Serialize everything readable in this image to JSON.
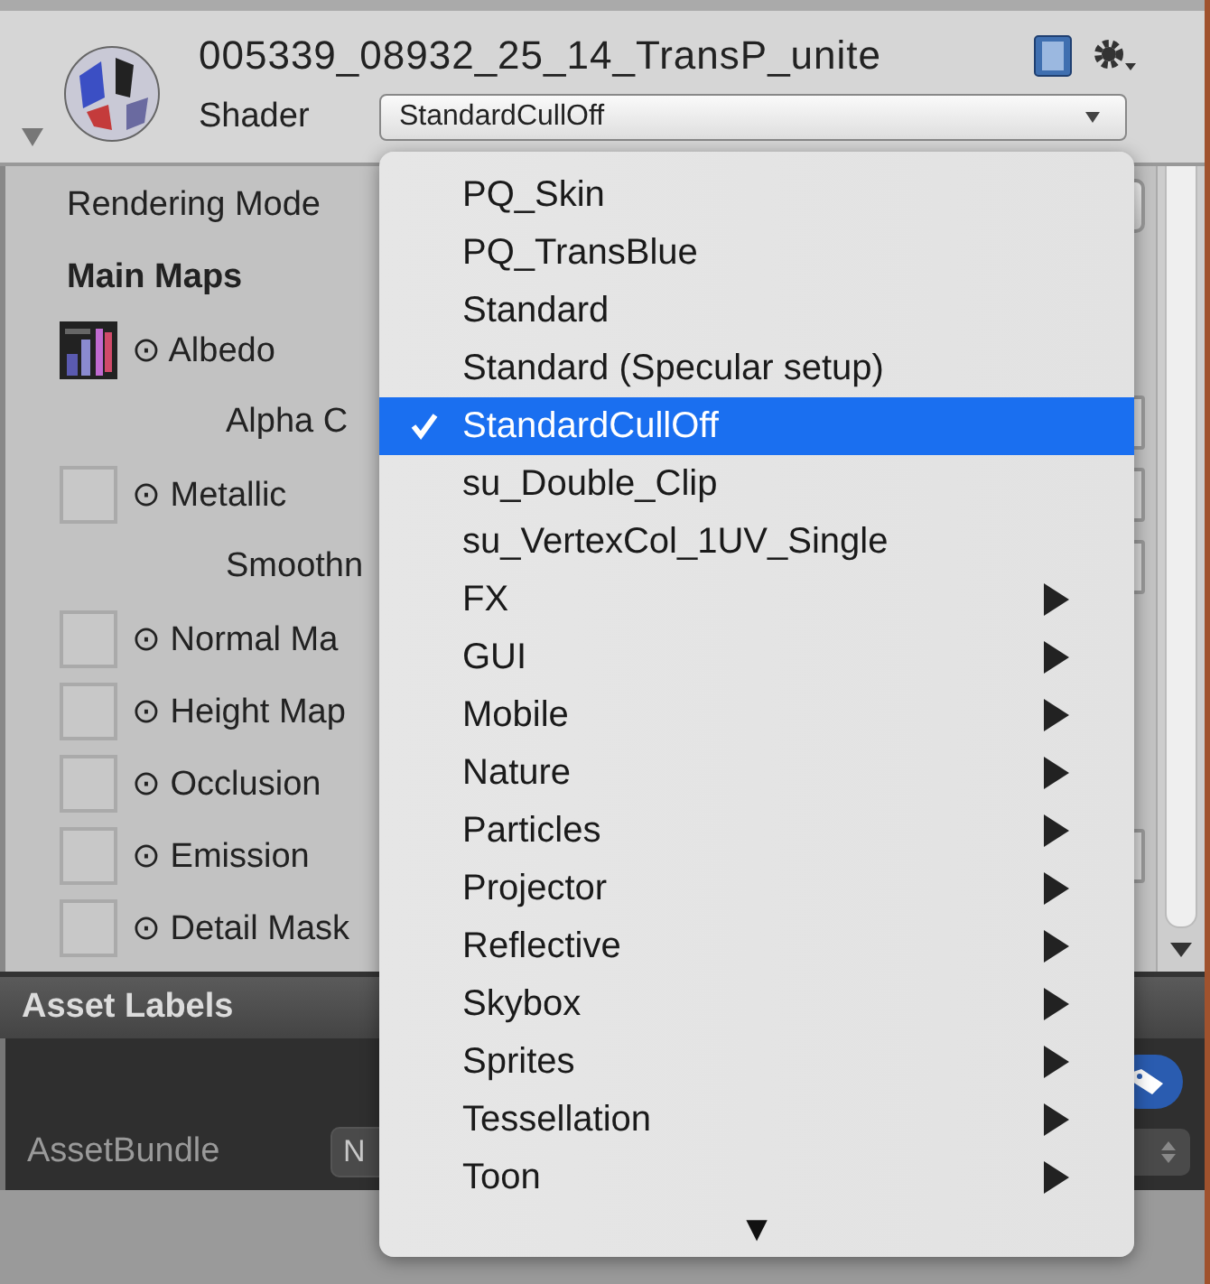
{
  "header": {
    "title": "005339_08932_25_14_TransP_unite",
    "shader_label": "Shader",
    "shader_value": "StandardCullOff"
  },
  "properties": [
    {
      "kind": "mode",
      "label": "Rendering Mode"
    },
    {
      "kind": "heading",
      "label": "Main Maps"
    },
    {
      "kind": "texture",
      "label": "⊙ Albedo",
      "assigned": true,
      "field": false
    },
    {
      "kind": "sub",
      "label": "Alpha C",
      "field": true
    },
    {
      "kind": "texture",
      "label": "⊙ Metallic",
      "assigned": false,
      "field": true
    },
    {
      "kind": "sub",
      "label": "Smoothn",
      "field": true
    },
    {
      "kind": "texture",
      "label": "⊙ Normal Ma",
      "assigned": false,
      "field": false
    },
    {
      "kind": "texture",
      "label": "⊙ Height Map",
      "assigned": false,
      "field": false
    },
    {
      "kind": "texture",
      "label": "⊙ Occlusion",
      "assigned": false,
      "field": false
    },
    {
      "kind": "texture",
      "label": "⊙ Emission",
      "assigned": false,
      "field": true
    },
    {
      "kind": "texture",
      "label": "⊙ Detail Mask",
      "assigned": false,
      "field": false
    }
  ],
  "asset_labels": {
    "title": "Asset Labels",
    "bundle_label": "AssetBundle",
    "bundle_value": "N"
  },
  "menu": {
    "items": [
      {
        "label": "PQ_Skin",
        "selected": false,
        "submenu": false
      },
      {
        "label": "PQ_TransBlue",
        "selected": false,
        "submenu": false
      },
      {
        "label": "Standard",
        "selected": false,
        "submenu": false
      },
      {
        "label": "Standard (Specular setup)",
        "selected": false,
        "submenu": false
      },
      {
        "label": "StandardCullOff",
        "selected": true,
        "submenu": false
      },
      {
        "label": "su_Double_Clip",
        "selected": false,
        "submenu": false
      },
      {
        "label": "su_VertexCol_1UV_Single",
        "selected": false,
        "submenu": false
      },
      {
        "label": "FX",
        "selected": false,
        "submenu": true
      },
      {
        "label": "GUI",
        "selected": false,
        "submenu": true
      },
      {
        "label": "Mobile",
        "selected": false,
        "submenu": true
      },
      {
        "label": "Nature",
        "selected": false,
        "submenu": true
      },
      {
        "label": "Particles",
        "selected": false,
        "submenu": true
      },
      {
        "label": "Projector",
        "selected": false,
        "submenu": true
      },
      {
        "label": "Reflective",
        "selected": false,
        "submenu": true
      },
      {
        "label": "Skybox",
        "selected": false,
        "submenu": true
      },
      {
        "label": "Sprites",
        "selected": false,
        "submenu": true
      },
      {
        "label": "Tessellation",
        "selected": false,
        "submenu": true
      },
      {
        "label": "Toon",
        "selected": false,
        "submenu": true
      }
    ],
    "more": "▼"
  }
}
